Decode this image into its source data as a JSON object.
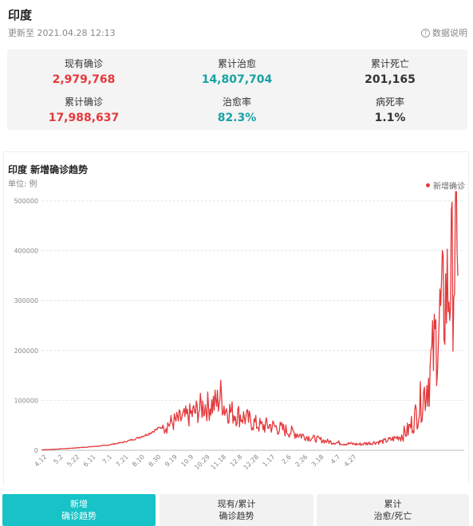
{
  "header": {
    "title": "印度",
    "updated": "更新至 2021.04.28 12:13",
    "explain": "数据说明"
  },
  "stats": [
    {
      "label": "现有确诊",
      "value": "2,979,768",
      "color": "red"
    },
    {
      "label": "累计治愈",
      "value": "14,807,704",
      "color": "teal"
    },
    {
      "label": "累计死亡",
      "value": "201,165",
      "color": "dark"
    },
    {
      "label": "累计确诊",
      "value": "17,988,637",
      "color": "red"
    },
    {
      "label": "治愈率",
      "value": "82.3%",
      "color": "teal"
    },
    {
      "label": "病死率",
      "value": "1.1%",
      "color": "dark"
    }
  ],
  "chart": {
    "title": "印度 新增确诊趋势",
    "unit": "单位: 例",
    "legend": "新增确诊"
  },
  "chart_data": {
    "type": "line",
    "title": "印度 新增确诊趋势",
    "ylabel": "单位: 例",
    "ylim": [
      0,
      500000
    ],
    "yticks": [
      "500000",
      "400000",
      "300000",
      "200000",
      "100000",
      "0"
    ],
    "categories": [
      "4.12",
      "5.2",
      "5.22",
      "6.11",
      "7.1",
      "7.21",
      "8.10",
      "8.30",
      "9.19",
      "10.9",
      "10.29",
      "11.18",
      "12.8",
      "12.28",
      "1.17",
      "2.6",
      "2.26",
      "3.18",
      "4.7",
      "4.27"
    ],
    "series": [
      {
        "name": "新增确诊",
        "color": "#e4393c",
        "points": [
          [
            0,
            800
          ],
          [
            20,
            2500
          ],
          [
            40,
            4500
          ],
          [
            60,
            7000
          ],
          [
            80,
            10000
          ],
          [
            100,
            16000
          ],
          [
            115,
            23000
          ],
          [
            130,
            32000
          ],
          [
            145,
            45000
          ],
          [
            160,
            55000
          ],
          [
            170,
            62000
          ],
          [
            180,
            68000
          ],
          [
            190,
            78000
          ],
          [
            195,
            85000
          ],
          [
            200,
            90000
          ],
          [
            205,
            88000
          ],
          [
            210,
            92000
          ],
          [
            215,
            95000
          ],
          [
            220,
            110000
          ],
          [
            225,
            85000
          ],
          [
            230,
            80000
          ],
          [
            235,
            75000
          ],
          [
            240,
            72000
          ],
          [
            250,
            65000
          ],
          [
            260,
            55000
          ],
          [
            270,
            48000
          ],
          [
            280,
            50000
          ],
          [
            290,
            45000
          ],
          [
            300,
            40000
          ],
          [
            310,
            35000
          ],
          [
            320,
            30000
          ],
          [
            330,
            25000
          ],
          [
            340,
            22000
          ],
          [
            350,
            18000
          ],
          [
            360,
            16000
          ],
          [
            370,
            14000
          ],
          [
            380,
            13000
          ],
          [
            390,
            12000
          ],
          [
            400,
            14000
          ],
          [
            410,
            16000
          ],
          [
            420,
            18000
          ],
          [
            430,
            22000
          ],
          [
            440,
            28000
          ],
          [
            450,
            40000
          ],
          [
            455,
            55000
          ],
          [
            460,
            72000
          ],
          [
            465,
            95000
          ],
          [
            470,
            115000
          ],
          [
            475,
            145000
          ],
          [
            480,
            185000
          ],
          [
            485,
            230000
          ],
          [
            490,
            270000
          ],
          [
            495,
            300000
          ],
          [
            500,
            330000
          ],
          [
            505,
            360000
          ],
          [
            510,
            400000
          ],
          [
            511,
            350000
          ]
        ]
      }
    ],
    "grid": true
  },
  "tabs": [
    {
      "line1": "新增",
      "line2": "确诊趋势",
      "active": true
    },
    {
      "line1": "现有/累计",
      "line2": "确诊趋势",
      "active": false
    },
    {
      "line1": "累计",
      "line2": "治愈/死亡",
      "active": false
    }
  ]
}
